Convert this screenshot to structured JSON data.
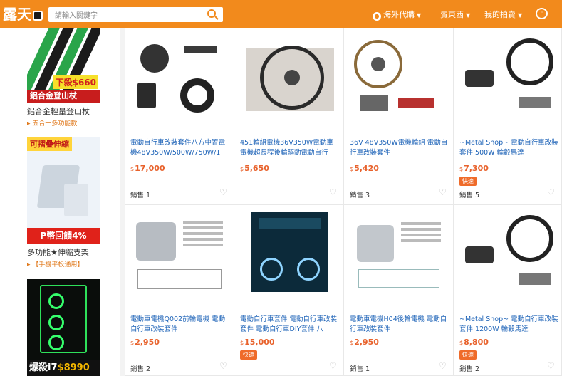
{
  "header": {
    "logo": "露天",
    "search_placeholder": "請輸入關鍵字",
    "nav": [
      {
        "label": "海外代購"
      },
      {
        "label": "賣東西"
      },
      {
        "label": "我的拍賣"
      }
    ]
  },
  "sidebar": {
    "ads": [
      {
        "promo": "下殺$660",
        "banner": "鋁合金登山杖",
        "title": "鋁合金輕量登山杖",
        "subtitle": "▸ 五合一多功能款"
      },
      {
        "ribbon": "可摺疊伸縮",
        "banner": "P幣回饋4%",
        "title": "多功能★伸縮支架",
        "subtitle": "▸ 【手機平板通用】"
      },
      {
        "banner_prefix": "爆殺",
        "banner_model": "i7",
        "banner_price": "$8990"
      }
    ]
  },
  "products": [
    {
      "title": "電動自行車改裝套件八方中置電機48V350W/500W/750W/1",
      "currency": "$",
      "price": "17,000",
      "fast": "",
      "sold": "銷售 1"
    },
    {
      "title": "451輪組電機36V350W電動車電機超長程後輪驅動電動自行",
      "currency": "$",
      "price": "5,650",
      "fast": "",
      "sold": ""
    },
    {
      "title": "36V 48V350W電機輪組 電動自行車改裝套件",
      "currency": "$",
      "price": "5,420",
      "fast": "",
      "sold": "銷售 3"
    },
    {
      "title": "~Metal Shop~ 電動自行車改裝套件 500W 輪轂馬達",
      "currency": "$",
      "price": "7,300",
      "fast": "快速",
      "sold": "銷售 5"
    },
    {
      "title": "電動車電機Q002前輪電機 電動自行車改裝套件",
      "currency": "$",
      "price": "2,950",
      "fast": "",
      "sold": "銷售 2"
    },
    {
      "title": "電動自行車套件 電動自行車改裝套件 電動自行車DIY套件 八",
      "currency": "$",
      "price": "15,000",
      "fast": "快速",
      "sold": ""
    },
    {
      "title": "電動車電機H04後輪電機 電動自行車改裝套件",
      "currency": "$",
      "price": "2,950",
      "fast": "",
      "sold": "銷售 1"
    },
    {
      "title": "~Metal Shop~ 電動自行車改裝套件 1200W 輪轂馬達",
      "currency": "$",
      "price": "8,800",
      "fast": "快速",
      "sold": "銷售 2"
    }
  ]
}
